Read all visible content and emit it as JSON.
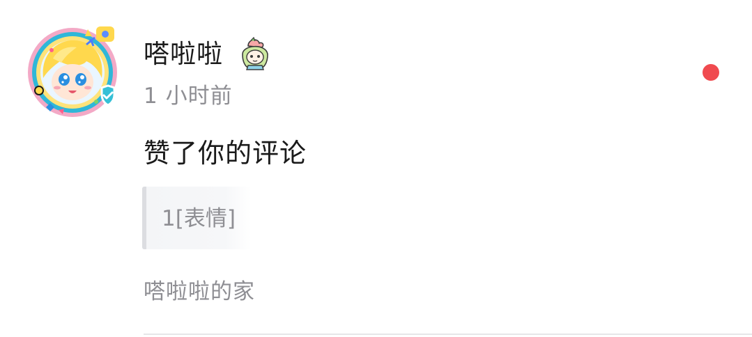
{
  "notification": {
    "username": "嗒啦啦",
    "timestamp": "1 小时前",
    "action": "赞了你的评论",
    "quoted_comment": "1[表情]",
    "source": "嗒啦啦的家",
    "user_badge_icon": "peach-character-badge-icon",
    "avatar_icon": "anime-avatar-with-verified-icon",
    "verified_icon": "verified-check-icon",
    "unread_icon": "unread-dot-icon"
  },
  "colors": {
    "primary_text": "#1a1a1a",
    "secondary_text": "#8e8e93",
    "unread_dot": "#f04a4f",
    "verified_badge": "#35c0d6",
    "quote_background": "#f5f6f8",
    "quote_bar": "#dcdde1",
    "divider": "#e6e6e8"
  }
}
